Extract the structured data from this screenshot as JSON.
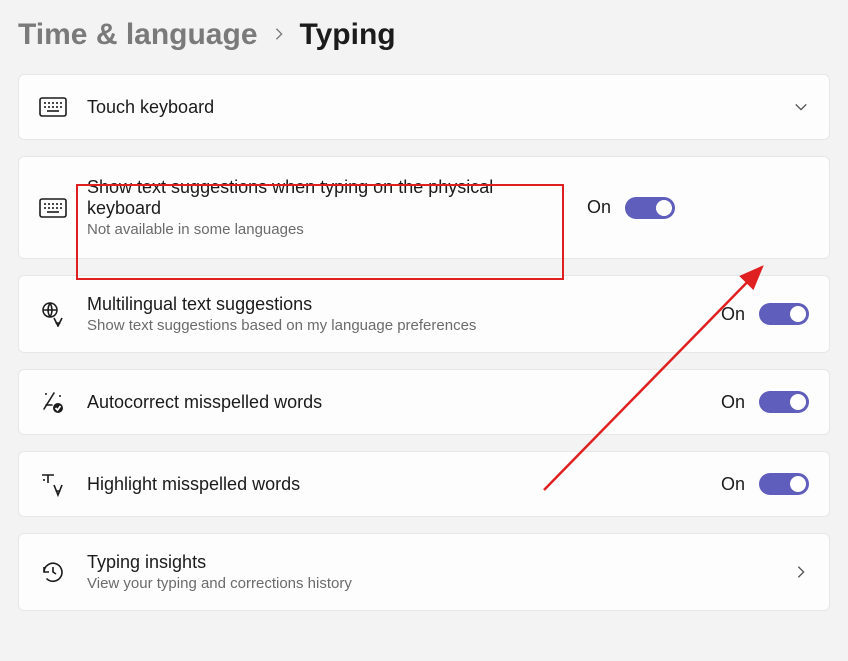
{
  "breadcrumb": {
    "parent": "Time & language",
    "current": "Typing"
  },
  "cards": {
    "touchKeyboard": {
      "title": "Touch keyboard"
    },
    "textSuggestions": {
      "title": "Show text suggestions when typing on the physical keyboard",
      "subtitle": "Not available in some languages",
      "state": "On"
    },
    "multilingual": {
      "title": "Multilingual text suggestions",
      "subtitle": "Show text suggestions based on my language preferences",
      "state": "On"
    },
    "autocorrect": {
      "title": "Autocorrect misspelled words",
      "state": "On"
    },
    "highlight": {
      "title": "Highlight misspelled words",
      "state": "On"
    },
    "insights": {
      "title": "Typing insights",
      "subtitle": "View your typing and corrections history"
    }
  },
  "colors": {
    "toggleAccent": "#605ebc",
    "highlightRed": "#e02020"
  }
}
